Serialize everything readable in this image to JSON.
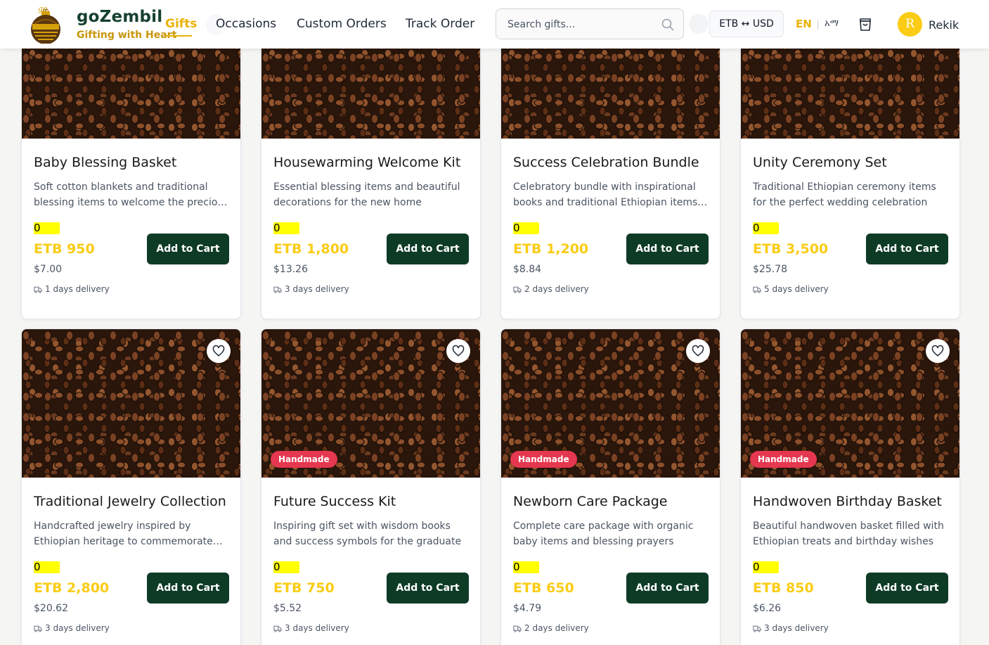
{
  "header": {
    "brand_name": "goZembil",
    "brand_tagline": "Gifting with Heart",
    "logo_text": "go",
    "nav": {
      "gifts": "Gifts",
      "occasions": "Occasions",
      "custom_orders": "Custom Orders",
      "track_order": "Track Order"
    },
    "search_placeholder": "Search gifts...",
    "currency_toggle": "ETB ↔ USD",
    "lang_en": "EN",
    "lang_sep": "|",
    "lang_am": "አማ",
    "user_initial": "R",
    "user_name": "Rekik"
  },
  "colors": {
    "brand_green": "#0e3b26",
    "accent_yellow": "#facc15",
    "badge_red": "#e5374f",
    "highlight": "#ffff00"
  },
  "products": [
    {
      "title": "Baby Blessing Basket",
      "description": "Soft cotton blankets and traditional blessing items to welcome the precious newborn",
      "qty": "0",
      "price_etb": "ETB 950",
      "price_usd": "$7.00",
      "delivery": "1 days delivery",
      "badge": "",
      "button": "Add to Cart"
    },
    {
      "title": "Housewarming Welcome Kit",
      "description": "Essential blessing items and beautiful decorations for the new home",
      "qty": "0",
      "price_etb": "ETB 1,800",
      "price_usd": "$13.26",
      "delivery": "3 days delivery",
      "badge": "",
      "button": "Add to Cart"
    },
    {
      "title": "Success Celebration Bundle",
      "description": "Celebratory bundle with inspirational books and traditional Ethiopian items for success",
      "qty": "0",
      "price_etb": "ETB 1,200",
      "price_usd": "$8.84",
      "delivery": "2 days delivery",
      "badge": "",
      "button": "Add to Cart"
    },
    {
      "title": "Unity Ceremony Set",
      "description": "Traditional Ethiopian ceremony items for the perfect wedding celebration",
      "qty": "0",
      "price_etb": "ETB 3,500",
      "price_usd": "$25.78",
      "delivery": "5 days delivery",
      "badge": "",
      "button": "Add to Cart"
    },
    {
      "title": "Traditional Jewelry Collection",
      "description": "Handcrafted jewelry inspired by Ethiopian heritage to commemorate special moments",
      "qty": "0",
      "price_etb": "ETB 2,800",
      "price_usd": "$20.62",
      "delivery": "3 days delivery",
      "badge": "",
      "button": "Add to Cart"
    },
    {
      "title": "Future Success Kit",
      "description": "Inspiring gift set with wisdom books and success symbols for the graduate",
      "qty": "0",
      "price_etb": "ETB 750",
      "price_usd": "$5.52",
      "delivery": "3 days delivery",
      "badge": "Handmade",
      "button": "Add to Cart"
    },
    {
      "title": "Newborn Care Package",
      "description": "Complete care package with organic baby items and blessing prayers",
      "qty": "0",
      "price_etb": "ETB 650",
      "price_usd": "$4.79",
      "delivery": "2 days delivery",
      "badge": "Handmade",
      "button": "Add to Cart"
    },
    {
      "title": "Handwoven Birthday Basket",
      "description": "Beautiful handwoven basket filled with Ethiopian treats and birthday wishes",
      "qty": "0",
      "price_etb": "ETB 850",
      "price_usd": "$6.26",
      "delivery": "3 days delivery",
      "badge": "Handmade",
      "button": "Add to Cart"
    }
  ]
}
